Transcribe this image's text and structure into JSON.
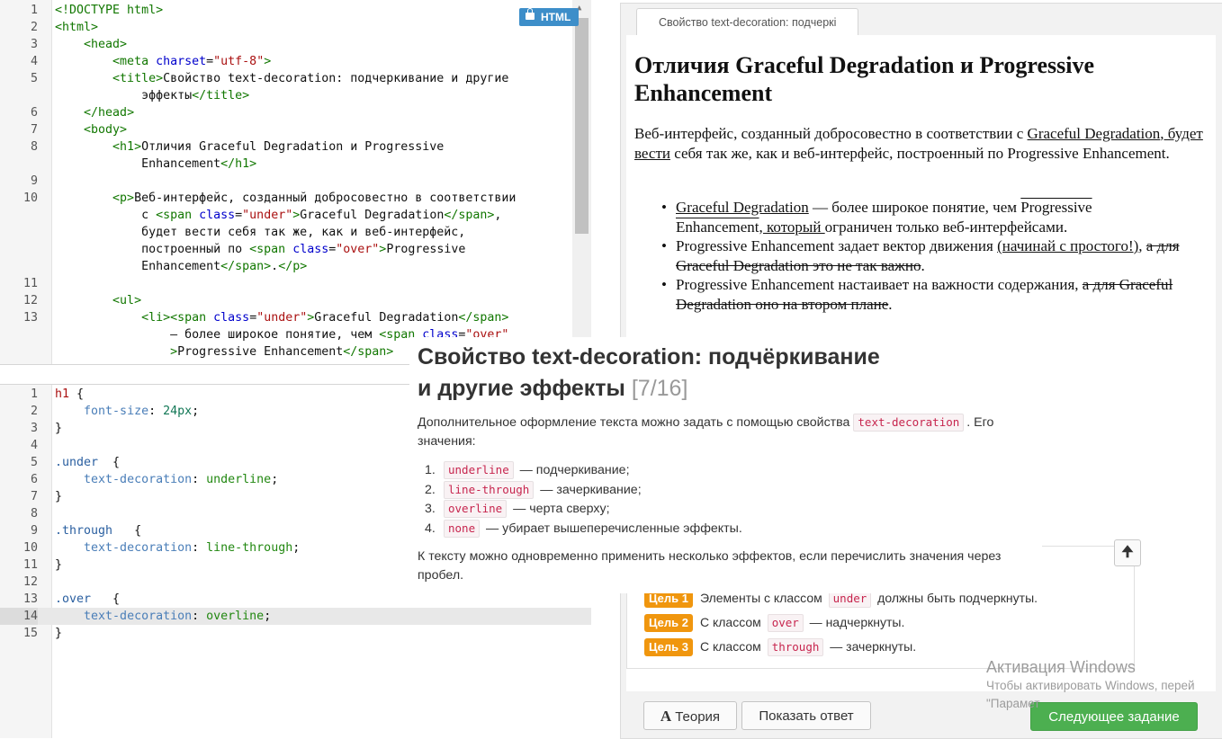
{
  "html_editor": {
    "mode_label": "HTML",
    "lines": [
      {
        "n": "1",
        "parts": [
          [
            "tag",
            "<!DOCTYPE html>"
          ]
        ]
      },
      {
        "n": "2",
        "parts": [
          [
            "tag",
            "<html>"
          ]
        ]
      },
      {
        "n": "3",
        "parts": [
          [
            "txt",
            "    "
          ],
          [
            "tag",
            "<head>"
          ]
        ]
      },
      {
        "n": "4",
        "parts": [
          [
            "txt",
            "        "
          ],
          [
            "tag",
            "<meta "
          ],
          [
            "attr",
            "charset"
          ],
          [
            "txt",
            "="
          ],
          [
            "str",
            "\"utf-8\""
          ],
          [
            "tag",
            ">"
          ]
        ]
      },
      {
        "n": "5",
        "parts": [
          [
            "txt",
            "        "
          ],
          [
            "tag",
            "<title>"
          ],
          [
            "txt",
            "Свойство text-decoration: подчеркивание и другие"
          ]
        ]
      },
      {
        "n": "",
        "parts": [
          [
            "txt",
            "            эффекты"
          ],
          [
            "tag",
            "</title>"
          ]
        ]
      },
      {
        "n": "6",
        "parts": [
          [
            "txt",
            "    "
          ],
          [
            "tag",
            "</head>"
          ]
        ]
      },
      {
        "n": "7",
        "parts": [
          [
            "txt",
            "    "
          ],
          [
            "tag",
            "<body>"
          ]
        ]
      },
      {
        "n": "8",
        "parts": [
          [
            "txt",
            "        "
          ],
          [
            "tag",
            "<h1>"
          ],
          [
            "txt",
            "Отличия Graceful Degradation и Progressive"
          ]
        ]
      },
      {
        "n": "",
        "parts": [
          [
            "txt",
            "            Enhancement"
          ],
          [
            "tag",
            "</h1>"
          ]
        ]
      },
      {
        "n": "9",
        "parts": []
      },
      {
        "n": "10",
        "parts": [
          [
            "txt",
            "        "
          ],
          [
            "tag",
            "<p>"
          ],
          [
            "txt",
            "Веб-интерфейс, созданный добросовестно в соответствии"
          ]
        ]
      },
      {
        "n": "",
        "parts": [
          [
            "txt",
            "            с "
          ],
          [
            "tag",
            "<span "
          ],
          [
            "attr",
            "class"
          ],
          [
            "txt",
            "="
          ],
          [
            "str",
            "\"under\""
          ],
          [
            "tag",
            ">"
          ],
          [
            "txt",
            "Graceful Degradation"
          ],
          [
            "tag",
            "</span>"
          ],
          [
            "txt",
            ","
          ]
        ]
      },
      {
        "n": "",
        "parts": [
          [
            "txt",
            "            будет вести себя так же, как и веб-интерфейс,"
          ]
        ]
      },
      {
        "n": "",
        "parts": [
          [
            "txt",
            "            построенный по "
          ],
          [
            "tag",
            "<span "
          ],
          [
            "attr",
            "class"
          ],
          [
            "txt",
            "="
          ],
          [
            "str",
            "\"over\""
          ],
          [
            "tag",
            ">"
          ],
          [
            "txt",
            "Progressive"
          ]
        ]
      },
      {
        "n": "",
        "parts": [
          [
            "txt",
            "            Enhancement"
          ],
          [
            "tag",
            "</span>"
          ],
          [
            "txt",
            "."
          ],
          [
            "tag",
            "</p>"
          ]
        ]
      },
      {
        "n": "11",
        "parts": []
      },
      {
        "n": "12",
        "parts": [
          [
            "txt",
            "        "
          ],
          [
            "tag",
            "<ul>"
          ]
        ]
      },
      {
        "n": "13",
        "parts": [
          [
            "txt",
            "            "
          ],
          [
            "tag",
            "<li>"
          ],
          [
            "tag",
            "<span "
          ],
          [
            "attr",
            "class"
          ],
          [
            "txt",
            "="
          ],
          [
            "str",
            "\"under\""
          ],
          [
            "tag",
            ">"
          ],
          [
            "txt",
            "Graceful Degradation"
          ],
          [
            "tag",
            "</span>"
          ]
        ]
      },
      {
        "n": "",
        "parts": [
          [
            "txt",
            "                — более широкое понятие, чем "
          ],
          [
            "tag",
            "<span "
          ],
          [
            "attr",
            "class"
          ],
          [
            "txt",
            "="
          ],
          [
            "str",
            "\"over\""
          ]
        ]
      },
      {
        "n": "",
        "parts": [
          [
            "txt",
            "                "
          ],
          [
            "tag",
            ">"
          ],
          [
            "txt",
            "Progressive Enhancement"
          ],
          [
            "tag",
            "</span>"
          ]
        ]
      }
    ]
  },
  "css_editor": {
    "active_line": "14",
    "lines": [
      {
        "n": "1",
        "parts": [
          [
            "sel",
            "h1"
          ],
          [
            "txt",
            " {"
          ]
        ]
      },
      {
        "n": "2",
        "parts": [
          [
            "txt",
            "    "
          ],
          [
            "prop",
            "font-size"
          ],
          [
            "txt",
            ": "
          ],
          [
            "num",
            "24px"
          ],
          [
            "txt",
            ";"
          ]
        ]
      },
      {
        "n": "3",
        "parts": [
          [
            "txt",
            "}"
          ]
        ]
      },
      {
        "n": "4",
        "parts": []
      },
      {
        "n": "5",
        "parts": [
          [
            "cls",
            ".under"
          ],
          [
            "txt",
            "  {"
          ]
        ]
      },
      {
        "n": "6",
        "parts": [
          [
            "txt",
            "    "
          ],
          [
            "prop",
            "text-decoration"
          ],
          [
            "txt",
            ": "
          ],
          [
            "val",
            "underline"
          ],
          [
            "txt",
            ";"
          ]
        ]
      },
      {
        "n": "7",
        "parts": [
          [
            "txt",
            "}"
          ]
        ]
      },
      {
        "n": "8",
        "parts": []
      },
      {
        "n": "9",
        "parts": [
          [
            "cls",
            ".through"
          ],
          [
            "txt",
            "   {"
          ]
        ]
      },
      {
        "n": "10",
        "parts": [
          [
            "txt",
            "    "
          ],
          [
            "prop",
            "text-decoration"
          ],
          [
            "txt",
            ": "
          ],
          [
            "val",
            "line-through"
          ],
          [
            "txt",
            ";"
          ]
        ]
      },
      {
        "n": "11",
        "parts": [
          [
            "txt",
            "}"
          ]
        ]
      },
      {
        "n": "12",
        "parts": []
      },
      {
        "n": "13",
        "parts": [
          [
            "cls",
            ".over"
          ],
          [
            "txt",
            "   {"
          ]
        ]
      },
      {
        "n": "14",
        "parts": [
          [
            "txt",
            "    "
          ],
          [
            "prop",
            "text-decoration"
          ],
          [
            "txt",
            ": "
          ],
          [
            "val",
            "overline"
          ],
          [
            "txt",
            ";"
          ]
        ]
      },
      {
        "n": "15",
        "parts": [
          [
            "txt",
            "}"
          ]
        ]
      }
    ]
  },
  "preview": {
    "tab_label": "Свойство text-decoration: подчеркі",
    "h1": "Отличия Graceful Degradation и Progressive Enhancement",
    "p": {
      "before": "Веб-интерфейс, созданный добросовестно в соответствии с ",
      "under": "Graceful Degradation",
      "middle": ", будет вести себя так же, как и веб-интерфейс, построенный по Progressive Enhancement."
    },
    "li1": {
      "under": "Graceful Degradation",
      "text1": " — более широкое понятие, чем ",
      "over": "Progressive Enhancement",
      "under2": ", который ",
      "text2": "ограничен только веб-интерфейсами."
    },
    "li2": {
      "text1": "Progressive Enhancement задает вектор движения ",
      "under": "(начинай с простого!)",
      "text2": ", ",
      "strike": "а для Graceful Degradation это не так важно",
      "text3": "."
    },
    "li3": {
      "text1": "Progressive Enhancement настаивает на важности содержания, ",
      "strike": "а для Graceful Degradation оно на втором плане",
      "text2": "."
    }
  },
  "goals": [
    {
      "badge": "Цель 1",
      "before": "Элементы с классом ",
      "code": "under",
      "after": " должны быть подчеркнуты."
    },
    {
      "badge": "Цель 2",
      "before": "С классом ",
      "code": "over",
      "after": " — надчеркнуты."
    },
    {
      "badge": "Цель 3",
      "before": "С классом ",
      "code": "through",
      "after": " — зачеркнуты."
    }
  ],
  "buttons": {
    "theory": "Теория",
    "theory_icon": "A",
    "show_answer": "Показать ответ",
    "next_task": "Следующее задание",
    "up_arrow": "🠉"
  },
  "theory": {
    "title_line1": "Свойство text-decoration: подчёркивание",
    "title_line2": "и другие эффекты",
    "counter": "[7/16]",
    "intro_before": "Дополнительное оформление текста можно задать с помощью свойства ",
    "intro_code": "text-decoration",
    "intro_after": ". Его",
    "intro_line2": "значения:",
    "items": [
      {
        "num": "1.",
        "code": "underline",
        "text": " — подчеркивание;"
      },
      {
        "num": "2.",
        "code": "line-through",
        "text": " — зачеркивание;"
      },
      {
        "num": "3.",
        "code": "overline",
        "text": " — черта сверху;"
      },
      {
        "num": "4.",
        "code": "none",
        "text": " — убирает вышеперечисленные эффекты."
      }
    ],
    "outro_line1": "К тексту можно одновременно применить несколько эффектов, если перечислить значения через",
    "outro_line2": "пробел."
  },
  "watermark": {
    "title": "Активация Windows",
    "line1": "Чтобы активировать Windows, перей",
    "line2": "\"Парамет"
  },
  "colors": {
    "accent_blue": "#3d8ec9",
    "goal_orange": "#f0960e",
    "green_button": "#4caf50",
    "code_pink": "#c7254e"
  }
}
